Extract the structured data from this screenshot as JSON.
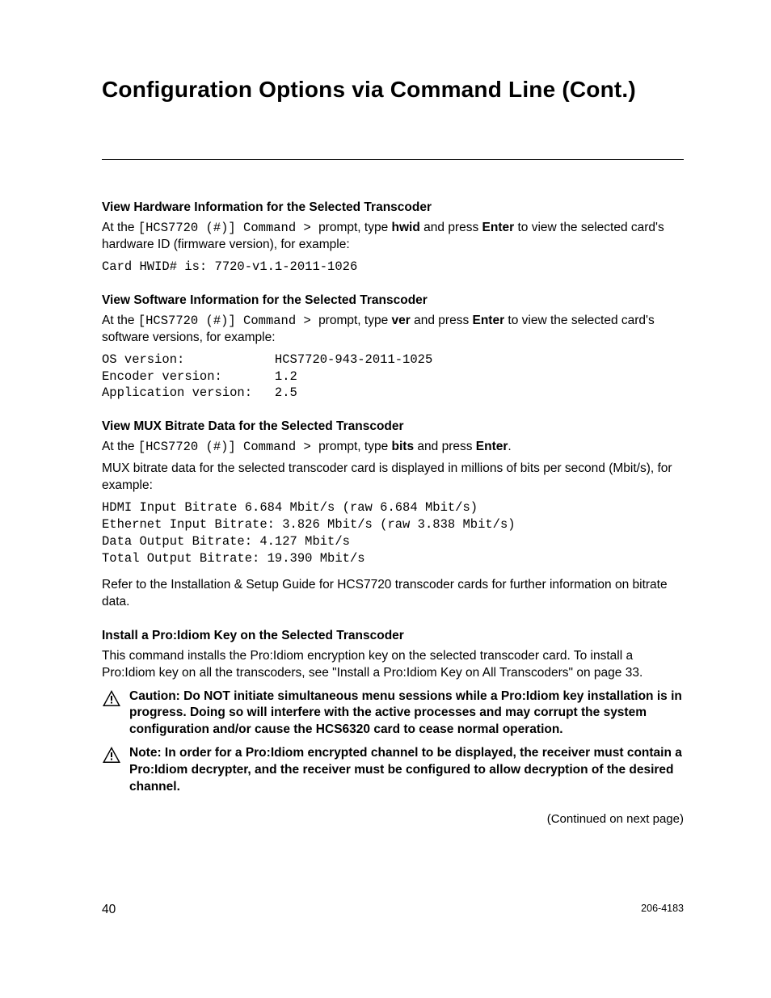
{
  "title": "Configuration Options via Command Line (Cont.)",
  "sections": {
    "hw": {
      "heading": "View Hardware Information for the Selected Transcoder",
      "p_prefix": "At the ",
      "p_prompt": "[HCS7720 (#)] Command > ",
      "p_mid": "prompt, type ",
      "p_cmd": "hwid",
      "p_mid2": " and press ",
      "p_enter": "Enter",
      "p_suffix": " to view the selected card's hardware ID (firmware version), for example:",
      "code": "Card HWID# is: 7720-v1.1-2011-1026"
    },
    "sw": {
      "heading": "View Software Information for the Selected Transcoder",
      "p_prefix": "At the ",
      "p_prompt": "[HCS7720 (#)] Command > ",
      "p_mid": "prompt, type ",
      "p_cmd": "ver",
      "p_mid2": " and press ",
      "p_enter": "Enter",
      "p_suffix": " to view the selected card's software versions, for example:",
      "code": "OS version:            HCS7720-943-2011-1025\nEncoder version:       1.2\nApplication version:   2.5"
    },
    "mux": {
      "heading": "View MUX Bitrate Data for the Selected Transcoder",
      "p_prefix": "At the ",
      "p_prompt": "[HCS7720 (#)] Command > ",
      "p_mid": "prompt, type ",
      "p_cmd": "bits",
      "p_mid2": " and press ",
      "p_enter": "Enter",
      "p_suffix": ".",
      "p2": "MUX bitrate data for the selected transcoder card is displayed in millions of bits per second (Mbit/s), for example:",
      "code": "HDMI Input Bitrate 6.684 Mbit/s (raw 6.684 Mbit/s)\nEthernet Input Bitrate: 3.826 Mbit/s (raw 3.838 Mbit/s)\nData Output Bitrate: 4.127 Mbit/s\nTotal Output Bitrate: 19.390 Mbit/s",
      "p3": "Refer to the Installation & Setup Guide for HCS7720 transcoder cards for further information on bitrate data."
    },
    "pi": {
      "heading": "Install a Pro:Idiom Key on the Selected Transcoder",
      "p1": "This command installs the Pro:Idiom encryption key on the selected transcoder card. To install a Pro:Idiom key on all the transcoders, see \"Install a Pro:Idiom Key on All Transcoders\" on page 33.",
      "caution": "Caution: Do NOT initiate simultaneous menu sessions while a Pro:Idiom key installation is in progress. Doing so will interfere with the active processes and may corrupt the system configuration and/or cause the HCS6320 card to cease normal operation.",
      "note": "Note: In order for a Pro:Idiom encrypted channel to be displayed, the receiver must contain a Pro:Idiom decrypter, and the receiver must be configured to allow decryption of the desired channel."
    }
  },
  "continued": "(Continued on next page)",
  "footer": {
    "page": "40",
    "doc": "206-4183"
  }
}
